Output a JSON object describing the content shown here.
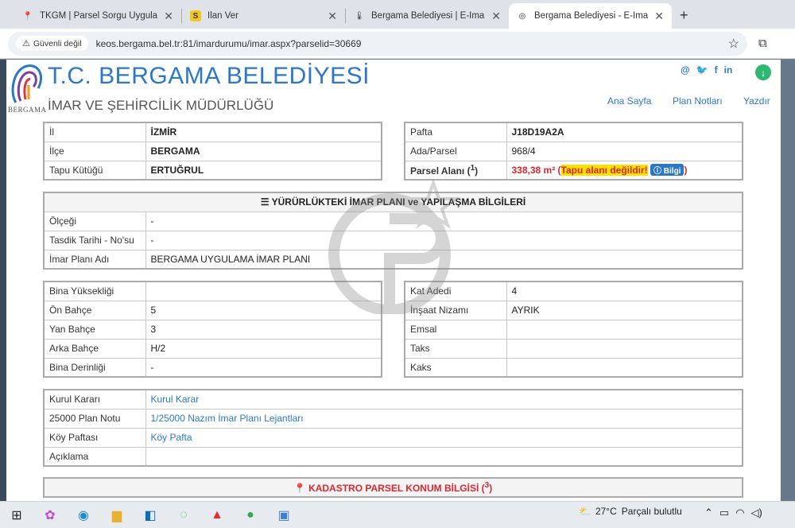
{
  "browser": {
    "tabs": [
      {
        "title": "TKGM | Parsel Sorgu Uygulama",
        "favicon": "location-pin-icon",
        "active": false
      },
      {
        "title": "İlan Ver",
        "favicon": "s-logo-icon",
        "active": false
      },
      {
        "title": "Bergama Belediyesi | E-İmar",
        "favicon": "thermometer-icon",
        "active": false
      },
      {
        "title": "Bergama Belediyesi - E-İmar",
        "favicon": "globe-icon",
        "active": true
      }
    ],
    "security_label": "Güvenli değil",
    "url": "keos.bergama.bel.tr:81/imardurumu/imar.aspx?parselid=30669"
  },
  "header": {
    "title": "T.C. BERGAMA BELEDİYESİ",
    "subtitle": "İMAR VE ŞEHİRCİLİK MÜDÜRLÜĞÜ",
    "logo_text": "BERGAMA",
    "socials": [
      "@",
      "🐦",
      "f",
      "in"
    ],
    "nav": [
      "Ana Sayfa",
      "Plan Notları",
      "Yazdır"
    ]
  },
  "location": {
    "rows": [
      {
        "label": "İl",
        "value": "İZMİR"
      },
      {
        "label": "İlçe",
        "value": "BERGAMA"
      },
      {
        "label": "Tapu Kütüğü",
        "value": "ERTUĞRUL"
      }
    ]
  },
  "parcel": {
    "rows": [
      {
        "label": "Pafta",
        "value": "J18D19A2A"
      },
      {
        "label": "Ada/Parsel",
        "value": "968/4"
      }
    ],
    "area_label": "Parsel Alanı",
    "area_sup": "1",
    "area_value": "338,38 m²",
    "area_note": "Tapu alanı değildir!",
    "info_button": "Bilgi"
  },
  "plan": {
    "heading": "YÜRÜRLÜKTEKİ İMAR PLANI ve YAPILAŞMA BİLGİLERİ",
    "rows": [
      {
        "label": "Ölçeği",
        "value": "-"
      },
      {
        "label": "Tasdik Tarihi - No'su",
        "value": "-"
      },
      {
        "label": "İmar Planı Adı",
        "value": "BERGAMA UYGULAMA İMAR PLANI"
      }
    ]
  },
  "building_left": {
    "rows": [
      {
        "label": "Bina Yüksekliği",
        "value": ""
      },
      {
        "label": "Ön Bahçe",
        "value": "5"
      },
      {
        "label": "Yan Bahçe",
        "value": "3"
      },
      {
        "label": "Arka Bahçe",
        "value": "H/2"
      },
      {
        "label": "Bina Derinliği",
        "value": "-"
      }
    ]
  },
  "building_right": {
    "rows": [
      {
        "label": "Kat Adedi",
        "value": "4"
      },
      {
        "label": "İnşaat Nizamı",
        "value": "AYRIK"
      },
      {
        "label": "Emsal",
        "value": ""
      },
      {
        "label": "Taks",
        "value": ""
      },
      {
        "label": "Kaks",
        "value": ""
      }
    ]
  },
  "notes": {
    "rows": [
      {
        "label": "Kurul Kararı",
        "value": "Kurul Karar"
      },
      {
        "label": "25000 Plan Notu",
        "value": "1/25000 Nazım İmar Planı Lejantları"
      },
      {
        "label": "Köy Paftası",
        "value": "Köy Pafta"
      },
      {
        "label": "Açıklama",
        "value": ""
      }
    ]
  },
  "kadastro": {
    "heading": "KADASTRO PARSEL KONUM BİLGİSİ",
    "sup": "3"
  },
  "taskbar": {
    "weather_temp": "27°C",
    "weather_text": "Parçalı bulutlu",
    "icons": [
      "widgets-icon",
      "copilot-icon",
      "edge-icon",
      "file-explorer-icon",
      "outlook-icon",
      "whatsapp-icon",
      "acrobat-icon",
      "chrome-icon",
      "photos-icon"
    ]
  }
}
